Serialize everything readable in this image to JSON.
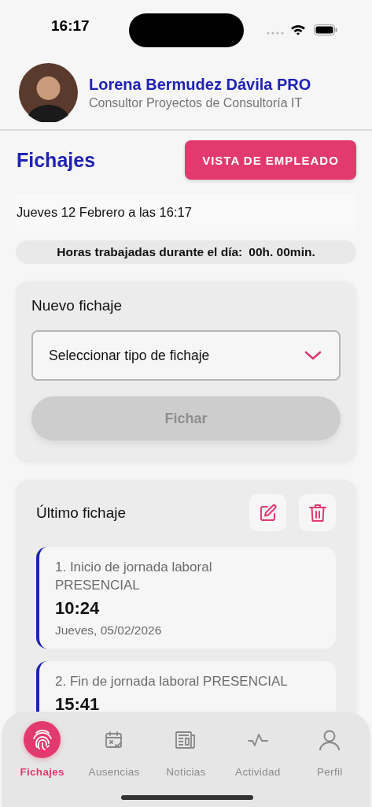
{
  "status_bar": {
    "time": "16:17"
  },
  "profile": {
    "name": "Lorena Bermudez Dávila PRO",
    "role": "Consultor Proyectos de Consultoría IT"
  },
  "page": {
    "title": "Fichajes",
    "action_button": "VISTA DE EMPLEADO"
  },
  "date_line": "Jueves 12 Febrero a las 16:17",
  "hours": {
    "label": "Horas trabajadas durante el día:",
    "value": "00h. 00min."
  },
  "new_entry": {
    "title": "Nuevo fichaje",
    "select": {
      "placeholder": "Seleccionar tipo de fichaje"
    },
    "submit": {
      "label": "Fichar",
      "disabled": true
    }
  },
  "last_entry": {
    "title": "Último fichaje",
    "records": [
      {
        "title": "1. Inicio de jornada laboral PRESENCIAL",
        "time": "10:24",
        "date": "Jueves, 05/02/2026"
      },
      {
        "title": "2. Fin de jornada laboral PRESENCIAL",
        "time": "15:41"
      }
    ]
  },
  "tab_bar": [
    {
      "label": "Fichajes",
      "selected": true
    },
    {
      "label": "Ausencias",
      "selected": false
    },
    {
      "label": "Noticias",
      "selected": false
    },
    {
      "label": "Actividad",
      "selected": false
    },
    {
      "label": "Perfil",
      "selected": false
    }
  ]
}
